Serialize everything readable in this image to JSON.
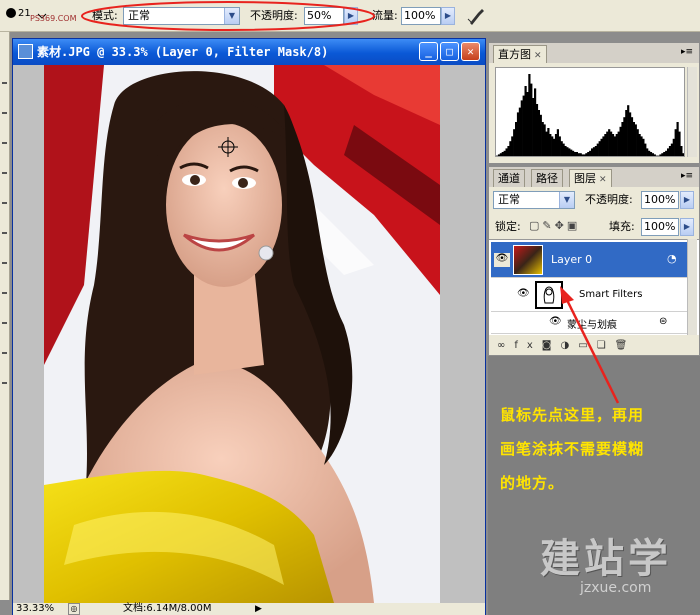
{
  "options_bar": {
    "brush_size": "21",
    "mode_label": "模式:",
    "mode_value": "正常",
    "opacity_label": "不透明度:",
    "opacity_value": "50%",
    "flow_label": "流量:",
    "flow_value": "100%",
    "watermark": "ps技术\nPS369.COM"
  },
  "document": {
    "title": "素材.JPG @ 33.3% (Layer 0, Filter Mask/8)",
    "zoom": "33.33%",
    "doc_size": "文档:6.14M/8.00M"
  },
  "histogram_panel": {
    "tab": "直方图",
    "bars": [
      2,
      3,
      4,
      5,
      6,
      8,
      10,
      14,
      18,
      24,
      30,
      38,
      42,
      48,
      52,
      60,
      55,
      70,
      62,
      50,
      58,
      45,
      40,
      36,
      30,
      28,
      22,
      25,
      20,
      18,
      16,
      20,
      24,
      18,
      14,
      12,
      10,
      9,
      8,
      7,
      6,
      5,
      5,
      4,
      4,
      3,
      3,
      4,
      5,
      6,
      8,
      9,
      10,
      12,
      14,
      16,
      18,
      20,
      22,
      24,
      22,
      20,
      18,
      20,
      22,
      26,
      30,
      34,
      40,
      44,
      38,
      34,
      30,
      28,
      24,
      20,
      18,
      16,
      12,
      8,
      6,
      5,
      4,
      3,
      2,
      2,
      3,
      4,
      5,
      6,
      8,
      10,
      12,
      16,
      24,
      30,
      22,
      10,
      4,
      2
    ]
  },
  "layers_panel": {
    "tabs": [
      "通道",
      "路径",
      "图层"
    ],
    "blend_mode": "正常",
    "opacity_label": "不透明度:",
    "opacity_value": "100%",
    "lock_label": "锁定:",
    "fill_label": "填充:",
    "fill_value": "100%",
    "layers": [
      {
        "name": "Layer 0",
        "selected": true
      },
      {
        "name": "Smart Filters",
        "selected": false
      },
      {
        "name": "蒙尘与划痕",
        "selected": false
      }
    ]
  },
  "annotation": {
    "lines": [
      "鼠标先点这里，再用",
      "画笔涂抹不需要模糊",
      "的地方。"
    ],
    "color": "#ffe400",
    "arrow_color": "#e8231e"
  },
  "watermark": {
    "text": "建站学",
    "url": "jzxue.com"
  }
}
